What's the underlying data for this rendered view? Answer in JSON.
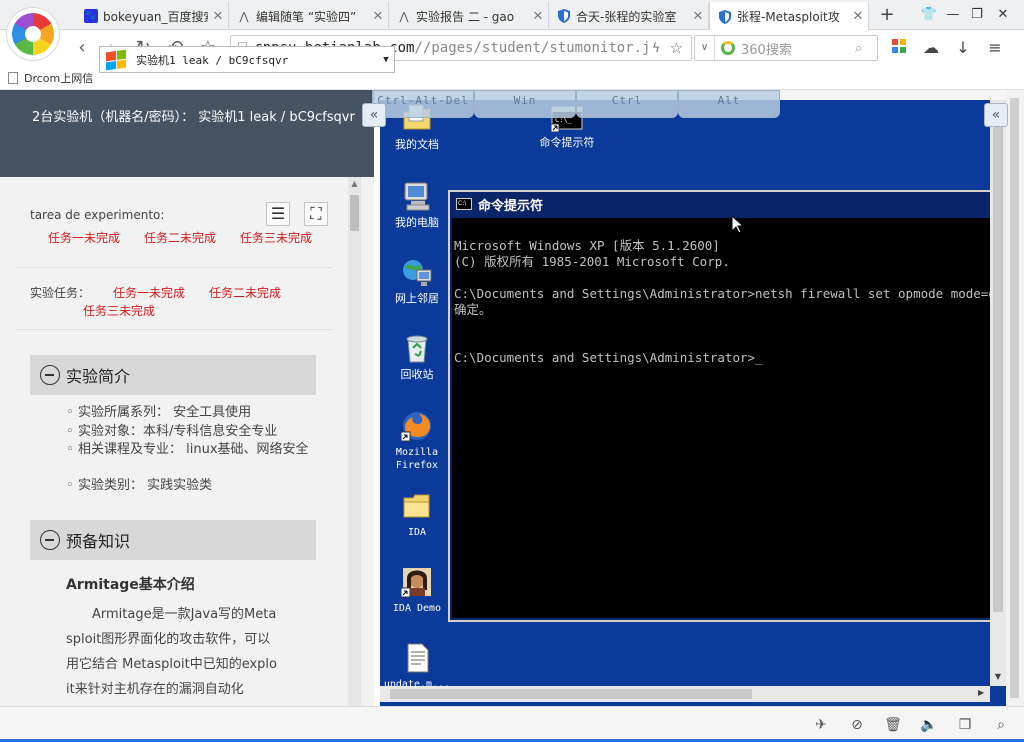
{
  "tabs": [
    {
      "label": "bokeyuan_百度搜索",
      "icon": "baidu-paw-icon",
      "active": false
    },
    {
      "label": "编辑随笔 “实验四”",
      "icon": "cnblogs-icon",
      "active": false
    },
    {
      "label": "实验报告 二 - gao",
      "icon": "cnblogs-icon",
      "active": false
    },
    {
      "label": "合天-张程的实验室",
      "icon": "shield-icon",
      "active": false
    },
    {
      "label": "张程-Metasploit攻",
      "icon": "shield-icon",
      "active": true
    }
  ],
  "address": {
    "host": "cppsu.hetianlab.com",
    "path": "//pages/student/stumonitor.js"
  },
  "search": {
    "placeholder": "360搜索"
  },
  "bookmarks": [
    {
      "label": "Drcom上网信"
    }
  ],
  "left": {
    "header_text": "2台实验机（机器名/密码）：  实验机1    leak / bC9cfsqvr",
    "vm_select": "实验机1    leak / bC9cfsqvr",
    "experiment_label": "tarea de experimento:",
    "experiment_tasks": [
      "任务一未完成",
      "任务二未完成",
      "任务三未完成"
    ],
    "task_label": "实验任务：",
    "tasks": [
      "任务一未完成",
      "任务二未完成",
      "任务三未完成"
    ],
    "intro": {
      "title": "实验简介",
      "items": [
        "实验所属系列：  安全工具使用",
        "实验对象：本科/专科信息安全专业",
        "相关课程及专业：  linux基础、网络安全",
        "实验类别：  实践实验类"
      ]
    },
    "prep": {
      "title": "预备知识",
      "subtitle": "Armitage基本介绍",
      "para": "　　Armitage是一款Java写的Metasploit图形界面化的攻击软件，可以用它结合 Metasploit中已知的exploit来针对主机存在的漏洞自动化"
    }
  },
  "hotkeys": [
    "Ctrl-Alt-Del",
    "Win",
    "Ctrl",
    "Alt"
  ],
  "desktop_icons": [
    {
      "label": "我的文档",
      "icon": "my-documents-icon"
    },
    {
      "label": "命令提示符",
      "icon": "command-prompt-icon"
    },
    {
      "label": "我的电脑",
      "icon": "my-computer-icon"
    },
    {
      "label": "网上邻居",
      "icon": "network-places-icon"
    },
    {
      "label": "回收站",
      "icon": "recycle-bin-icon"
    },
    {
      "label": "Mozilla Firefox",
      "icon": "firefox-icon"
    },
    {
      "label": "IDA",
      "icon": "folder-icon"
    },
    {
      "label": "IDA Demo",
      "icon": "ida-demo-icon"
    },
    {
      "label": "update.m...",
      "icon": "text-file-icon"
    }
  ],
  "cmd": {
    "title": "命令提示符",
    "lines": [
      "Microsoft Windows XP [版本 5.1.2600]",
      "(C) 版权所有 1985-2001 Microsoft Corp.",
      "",
      "C:\\Documents and Settings\\Administrator>netsh firewall set opmode mode=disable",
      "确定。",
      "",
      "",
      "C:\\Documents and Settings\\Administrator>_"
    ]
  },
  "colors": {
    "desktop_blue": "#0b3a9a",
    "cmd_title_blue": "#0a246a",
    "task_red": "#d21d1d",
    "header_slate": "#485361"
  }
}
